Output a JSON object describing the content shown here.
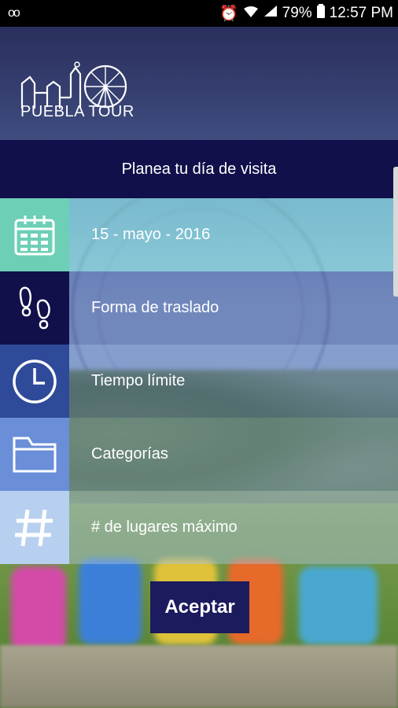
{
  "status_bar": {
    "voicemail": "oo",
    "battery": "79%",
    "time": "12:57 PM"
  },
  "header": {
    "logo_text": "PUEBLA TOUR"
  },
  "title": "Planea tu día de visita",
  "menu": [
    {
      "label": "15 - mayo - 2016",
      "icon": "calendar-icon"
    },
    {
      "label": "Forma de traslado",
      "icon": "footprints-icon"
    },
    {
      "label": "Tiempo límite",
      "icon": "clock-icon"
    },
    {
      "label": "Categorías",
      "icon": "folder-icon"
    },
    {
      "label": "# de lugares máximo",
      "icon": "hashtag-icon"
    }
  ],
  "accept_button": "Aceptar",
  "colors": {
    "dark_navy": "#11104a",
    "teal": "#6dcfb6",
    "blue": "#2f4a98",
    "light_blue": "#b7d0ef"
  }
}
